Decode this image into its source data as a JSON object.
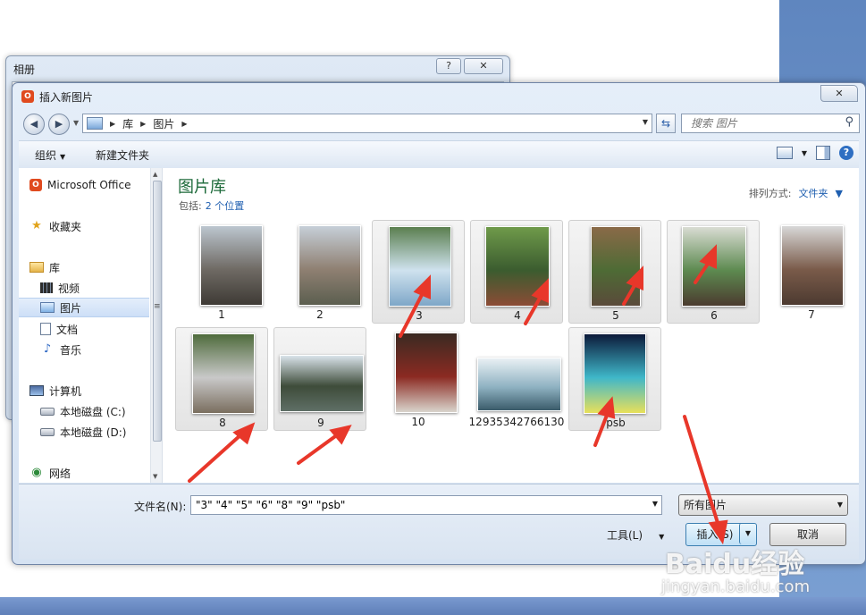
{
  "album_dialog": {
    "title": "相册",
    "help": "?",
    "close": "✕"
  },
  "dialog": {
    "title": "插入新图片",
    "close": "✕"
  },
  "address": {
    "crumbs": [
      "库",
      "图片"
    ],
    "search_placeholder": "搜索 图片"
  },
  "toolbar": {
    "organize": "组织",
    "new_folder": "新建文件夹"
  },
  "sidebar": {
    "items": [
      {
        "label": "Microsoft Office",
        "icon": "office-icon"
      },
      {
        "label": "收藏夹",
        "icon": "star-icon"
      },
      {
        "label": "库",
        "icon": "library-icon"
      },
      {
        "label": "视频",
        "icon": "video-icon"
      },
      {
        "label": "图片",
        "icon": "picture-icon",
        "selected": true
      },
      {
        "label": "文档",
        "icon": "document-icon"
      },
      {
        "label": "音乐",
        "icon": "music-icon"
      },
      {
        "label": "计算机",
        "icon": "computer-icon"
      },
      {
        "label": "本地磁盘 (C:)",
        "icon": "disk-icon"
      },
      {
        "label": "本地磁盘 (D:)",
        "icon": "disk-icon"
      },
      {
        "label": "网络",
        "icon": "network-icon"
      }
    ]
  },
  "library": {
    "title": "图片库",
    "includes_label": "包括:",
    "includes_link": "2 个位置",
    "arrange_label": "排列方式:",
    "arrange_value": "文件夹"
  },
  "files": [
    {
      "name": "1",
      "selected": false,
      "colors": [
        "#bcc6cf",
        "#6f6a64",
        "#3e3a35"
      ]
    },
    {
      "name": "2",
      "selected": false,
      "colors": [
        "#c6cfd8",
        "#8f8072",
        "#5b5e4f"
      ]
    },
    {
      "name": "3",
      "selected": true,
      "colors": [
        "#5b7f4f",
        "#cfe2ee",
        "#7ea7c8"
      ]
    },
    {
      "name": "4",
      "selected": true,
      "colors": [
        "#6f9a4a",
        "#3b5c2f",
        "#8c4c36"
      ]
    },
    {
      "name": "5",
      "selected": true,
      "colors": [
        "#8a6a48",
        "#4e6b35",
        "#5a4a3a"
      ]
    },
    {
      "name": "6",
      "selected": true,
      "colors": [
        "#d9dcd3",
        "#5d8a50",
        "#4b3b2f"
      ]
    },
    {
      "name": "7",
      "selected": false,
      "colors": [
        "#d8d8d8",
        "#7a5b4a",
        "#4c3a30"
      ]
    },
    {
      "name": "8",
      "selected": true,
      "colors": [
        "#4f6b3c",
        "#c9c9c9",
        "#7a6e5f"
      ]
    },
    {
      "name": "9",
      "selected": true,
      "colors": [
        "#d9e3ea",
        "#3e4c3a",
        "#5f6f66"
      ]
    },
    {
      "name": "10",
      "selected": false,
      "colors": [
        "#3a2a22",
        "#8b2a22",
        "#d9d4cc"
      ]
    },
    {
      "name": "12935342766130",
      "selected": false,
      "colors": [
        "#e9f0f4",
        "#8fb2c2",
        "#3a5b6a"
      ]
    },
    {
      "name": "psb",
      "selected": true,
      "colors": [
        "#0c1a3a",
        "#3fb7c9",
        "#e8e05a"
      ]
    }
  ],
  "bottom": {
    "filename_label": "文件名(N):",
    "filename_value": "\"3\" \"4\" \"5\" \"6\" \"8\" \"9\" \"psb\"",
    "filetype": "所有图片",
    "tools": "工具(L)",
    "insert": "插入(S)",
    "cancel": "取消"
  },
  "watermark": {
    "brand": "Baidu经验",
    "url": "jingyan.baidu.com"
  },
  "colors": {
    "accent": "#1f5fb0",
    "title_green": "#1d6a3a",
    "arrow_red": "#e8372a"
  }
}
